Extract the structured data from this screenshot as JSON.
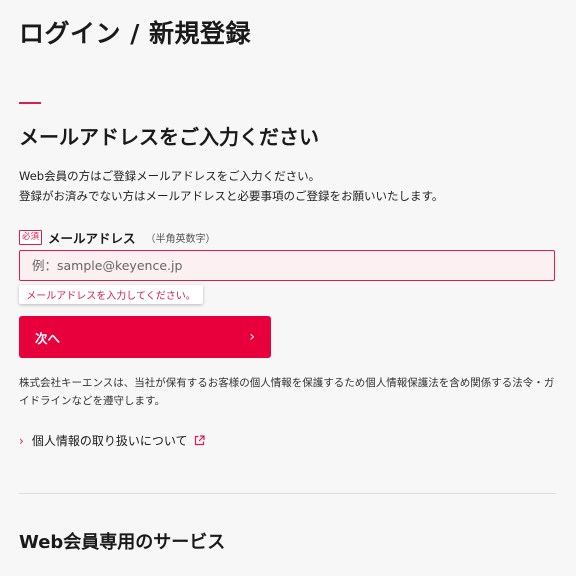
{
  "header": {
    "title": "ログイン / 新規登録"
  },
  "section": {
    "heading": "メールアドレスをご入力ください",
    "intro_line1": "Web会員の方はご登録メールアドレスをご入力ください。",
    "intro_line2": "登録がお済みでない方はメールアドレスと必要事項のご登録をお願いいたします。"
  },
  "email_field": {
    "required_badge": "必須",
    "label": "メールアドレス",
    "hint": "（半角英数字）",
    "value": "",
    "placeholder": "例：sample@keyence.jp",
    "error": "メールアドレスを入力してください。"
  },
  "next_button": {
    "label": "次へ",
    "icon": "chevron-right-icon"
  },
  "privacy": {
    "text": "株式会社キーエンスは、当社が保有するお客様の個人情報を保護するため個人情報保護法を含め関係する法令・ガイドラインなどを遵守します。",
    "link_label": "個人情報の取り扱いについて",
    "link_icon": "external-link-icon"
  },
  "services": {
    "heading": "Web会員専用のサービス"
  },
  "colors": {
    "accent": "#e8003d",
    "error": "#d6204f",
    "background": "#f7f7f7"
  }
}
